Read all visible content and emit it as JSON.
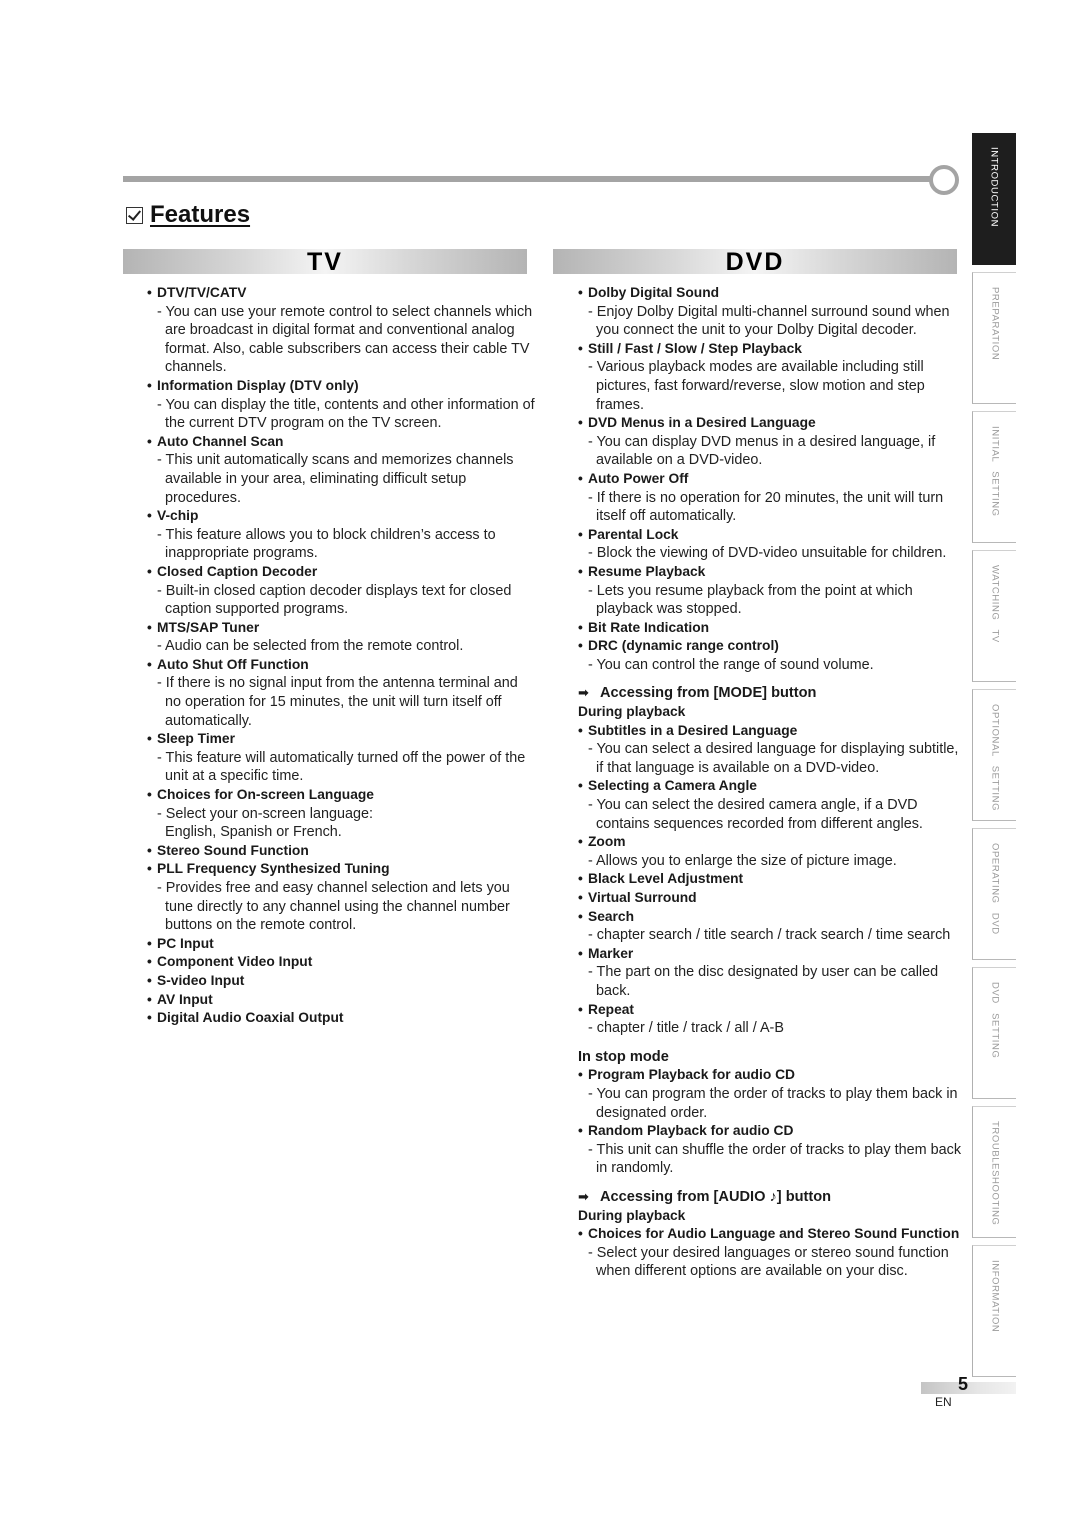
{
  "header": {
    "title": "Features",
    "checkbox_icon": "checked-box-icon"
  },
  "sections": {
    "tv": {
      "label": "TV",
      "features": [
        {
          "title": "DTV/TV/CATV",
          "desc": "You can use your remote control to select channels which are broadcast in digital format and conventional analog format. Also, cable subscribers can access their cable TV channels."
        },
        {
          "title": "Information Display (DTV only)",
          "desc": "You can display the title, contents and other information of the current DTV program on the TV screen."
        },
        {
          "title": "Auto Channel Scan",
          "desc": "This unit automatically scans and memorizes channels available in your area, eliminating difficult setup procedures."
        },
        {
          "title": "V-chip",
          "desc": "This feature allows you to block children’s access to inappropriate programs."
        },
        {
          "title": "Closed Caption Decoder",
          "desc": "Built-in closed caption decoder displays text for closed caption supported programs."
        },
        {
          "title": "MTS/SAP Tuner",
          "desc": "Audio can be selected from the remote control."
        },
        {
          "title": "Auto Shut Off Function",
          "desc": "If there is no signal input from the antenna terminal and no operation for 15 minutes, the unit will turn itself off automatically."
        },
        {
          "title": "Sleep Timer",
          "desc": "This feature will automatically turned off the power of the unit at a specific time."
        },
        {
          "title": "Choices for On-screen Language",
          "desc": "Select your on-screen language:",
          "desc2": "English, Spanish or French."
        },
        {
          "title": "Stereo Sound Function"
        },
        {
          "title": "PLL Frequency Synthesized Tuning",
          "desc": "Provides free and easy channel selection and lets you tune directly to any channel using the channel number buttons on the remote control."
        },
        {
          "title": "PC Input"
        },
        {
          "title": "Component Video Input"
        },
        {
          "title": "S-video Input"
        },
        {
          "title": "AV Input"
        },
        {
          "title": "Digital Audio Coaxial Output"
        }
      ]
    },
    "dvd": {
      "label": "DVD",
      "features": [
        {
          "title": "Dolby Digital Sound",
          "desc": "Enjoy Dolby Digital multi-channel surround sound when you connect the unit to your Dolby Digital decoder."
        },
        {
          "title": "Still / Fast / Slow / Step Playback",
          "desc": "Various playback modes are available including still pictures, fast forward/reverse, slow motion and step frames."
        },
        {
          "title": "DVD Menus in a Desired Language",
          "desc": "You can display DVD menus in a desired language, if available on a DVD-video."
        },
        {
          "title": "Auto Power Off",
          "desc": "If there is no operation for 20 minutes, the unit will turn itself off automatically."
        },
        {
          "title": "Parental Lock",
          "desc": "Block the viewing of DVD-video unsuitable for children."
        },
        {
          "title": "Resume Playback",
          "desc": "Lets you resume playback from the point at which playback was stopped."
        },
        {
          "title": "Bit Rate Indication"
        },
        {
          "title": "DRC (dynamic range control)",
          "desc": "You can control the range of sound volume."
        }
      ],
      "mode_button": {
        "heading": "Accessing from [MODE] button",
        "arrow_icon": "➡",
        "subheading": "During playback",
        "features": [
          {
            "title": "Subtitles in a Desired Language",
            "desc": "You can select a desired language for displaying subtitle, if that language is available on a DVD-video."
          },
          {
            "title": "Selecting a Camera Angle",
            "desc": "You can select the desired camera angle, if a DVD contains sequences recorded from different angles."
          },
          {
            "title": "Zoom",
            "desc": "Allows you to enlarge the size of picture image."
          },
          {
            "title": "Black Level Adjustment"
          },
          {
            "title": "Virtual Surround"
          },
          {
            "title": "Search",
            "desc": "chapter search / title search / track search / time search"
          },
          {
            "title": "Marker",
            "desc": "The part on the disc designated by user can be called back."
          },
          {
            "title": "Repeat",
            "desc": "chapter / title / track / all / A-B"
          }
        ]
      },
      "stop_mode": {
        "heading": "In stop mode",
        "features": [
          {
            "title": "Program Playback for audio CD",
            "desc": "You can program the order of tracks to play them back in designated order."
          },
          {
            "title": "Random Playback for audio CD",
            "desc": "This unit can shuffle the order of tracks to play them back in randomly."
          }
        ]
      },
      "audio_button": {
        "heading": "Accessing from [AUDIO ♪] button",
        "arrow_icon": "➡",
        "subheading": "During playback",
        "features": [
          {
            "title": "Choices for Audio Language and Stereo Sound Function",
            "desc": "Select your desired languages or stereo sound function when different options are available on your disc."
          }
        ]
      }
    }
  },
  "side_tabs": [
    {
      "label": "INTRODUCTION",
      "active": true
    },
    {
      "label": "PREPARATION",
      "active": false
    },
    {
      "label": "INITIAL SETTING",
      "active": false
    },
    {
      "label": "WATCHING TV",
      "active": false
    },
    {
      "label": "OPTIONAL SETTING",
      "active": false
    },
    {
      "label": "OPERATING DVD",
      "active": false
    },
    {
      "label": "DVD SETTING",
      "active": false
    },
    {
      "label": "TROUBLESHOOTING",
      "active": false
    },
    {
      "label": "INFORMATION",
      "active": false
    }
  ],
  "footer": {
    "page_number": "5",
    "language": "EN"
  }
}
